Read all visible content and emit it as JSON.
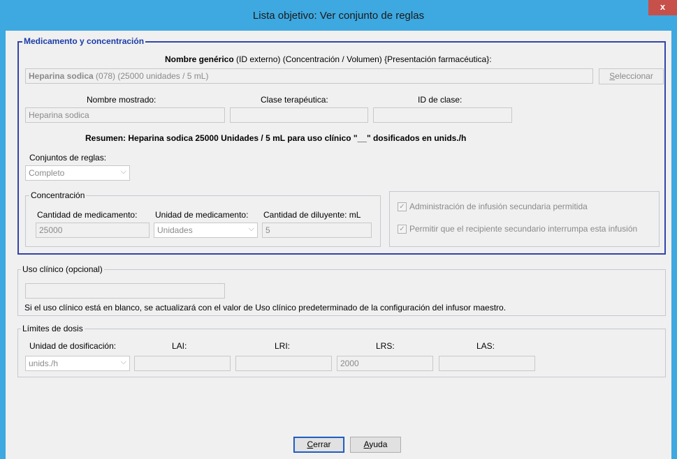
{
  "window": {
    "title": "Lista objetivo: Ver conjunto de reglas",
    "close_glyph": "x"
  },
  "med_section": {
    "legend": "Medicamento y concentración",
    "generic_header_bold": "Nombre genérico",
    "generic_header_rest": " (ID externo) (Concentración / Volumen) {Presentación farmacéutica}:",
    "generic_value_bold": "Heparina sodica",
    "generic_value_rest": " (078) (25000 unidades / 5 mL)",
    "select_button_first": "S",
    "select_button_rest": "eleccionar",
    "display_name_label": "Nombre mostrado:",
    "display_name_value": "Heparina sodica",
    "therapeutic_class_label": "Clase terapéutica:",
    "therapeutic_class_value": "",
    "class_id_label": "ID de clase:",
    "class_id_value": "",
    "summary": "Resumen: Heparina sodica 25000 Unidades / 5 mL para uso clínico \"__\" dosificados en unids./h",
    "rule_sets_label": "Conjuntos de reglas:",
    "rule_sets_value": "Completo",
    "concentration": {
      "legend": "Concentración",
      "drug_amount_label": "Cantidad de medicamento:",
      "drug_amount_value": "25000",
      "drug_unit_label": "Unidad de medicamento:",
      "drug_unit_value": "Unidades",
      "diluent_label": "Cantidad de diluyente: mL",
      "diluent_value": "5"
    },
    "checks": [
      {
        "label": "Administración de infusión secundaria permitida",
        "checked": true
      },
      {
        "label": "Permitir que el recipiente secundario interrumpa esta infusión",
        "checked": true
      }
    ]
  },
  "clinical_use": {
    "legend": "Uso clínico (opcional)",
    "value": "",
    "note": "Si el uso clínico está en blanco, se actualizará con el valor de Uso clínico predeterminado de la configuración del infusor maestro."
  },
  "dose_limits": {
    "legend": "Límites de dosis",
    "dosing_unit_label": "Unidad de dosificación:",
    "dosing_unit_value": "unids./h",
    "lai_label": "LAI:",
    "lai_value": "",
    "lri_label": "LRI:",
    "lri_value": "",
    "lrs_label": "LRS:",
    "lrs_value": "2000",
    "las_label": "LAS:",
    "las_value": ""
  },
  "buttons": {
    "close_first": "C",
    "close_rest": "errar",
    "help_first": "A",
    "help_rest": "yuda"
  },
  "colors": {
    "frame": "#3ea8e0",
    "section_border": "#3344aa",
    "legend_text": "#1a3ca8",
    "close_button": "#c7504a"
  }
}
